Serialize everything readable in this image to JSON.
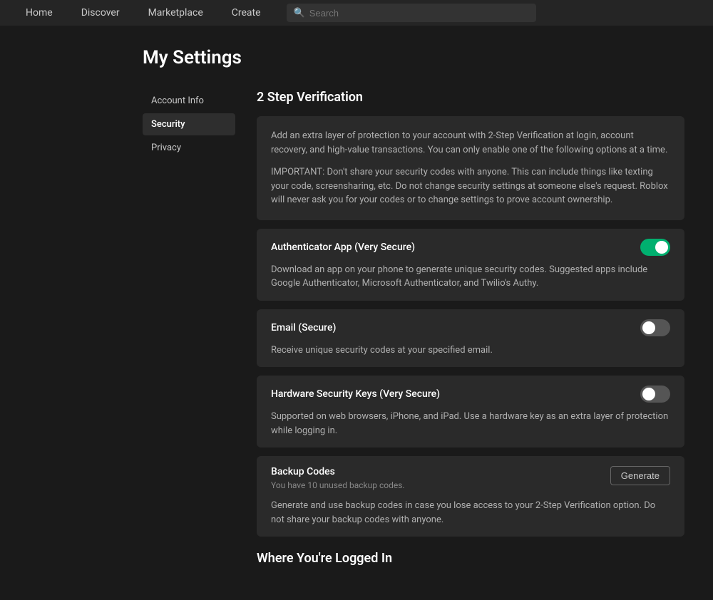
{
  "nav": {
    "items": [
      {
        "label": "Home",
        "id": "home"
      },
      {
        "label": "Discover",
        "id": "discover"
      },
      {
        "label": "Marketplace",
        "id": "marketplace"
      },
      {
        "label": "Create",
        "id": "create"
      }
    ],
    "search_placeholder": "Search"
  },
  "page": {
    "title": "My Settings"
  },
  "sidebar": {
    "items": [
      {
        "label": "Account Info",
        "id": "account-info",
        "active": false
      },
      {
        "label": "Security",
        "id": "security",
        "active": true
      },
      {
        "label": "Privacy",
        "id": "privacy",
        "active": false
      }
    ]
  },
  "main": {
    "section_title": "2 Step Verification",
    "info_block": {
      "text1": "Add an extra layer of protection to your account with 2-Step Verification at login, account recovery, and high-value transactions. You can only enable one of the following options at a time.",
      "text2": "IMPORTANT: Don't share your security codes with anyone. This can include things like texting your code, screensharing, etc. Do not change security settings at someone else's request. Roblox will never ask you for your codes or to change settings to prove account ownership."
    },
    "options": [
      {
        "id": "authenticator",
        "title": "Authenticator App (Very Secure)",
        "description": "Download an app on your phone to generate unique security codes. Suggested apps include Google Authenticator, Microsoft Authenticator, and Twilio's Authy.",
        "enabled": true
      },
      {
        "id": "email",
        "title": "Email (Secure)",
        "description": "Receive unique security codes at your specified email.",
        "enabled": false
      },
      {
        "id": "hardware",
        "title": "Hardware Security Keys (Very Secure)",
        "description": "Supported on web browsers, iPhone, and iPad. Use a hardware key as an extra layer of protection while logging in.",
        "enabled": false
      }
    ],
    "backup_codes": {
      "title": "Backup Codes",
      "subtitle": "You have 10 unused backup codes.",
      "generate_label": "Generate",
      "description": "Generate and use backup codes in case you lose access to your 2-Step Verification option. Do not share your backup codes with anyone."
    },
    "next_section_title": "Where You're Logged In"
  }
}
